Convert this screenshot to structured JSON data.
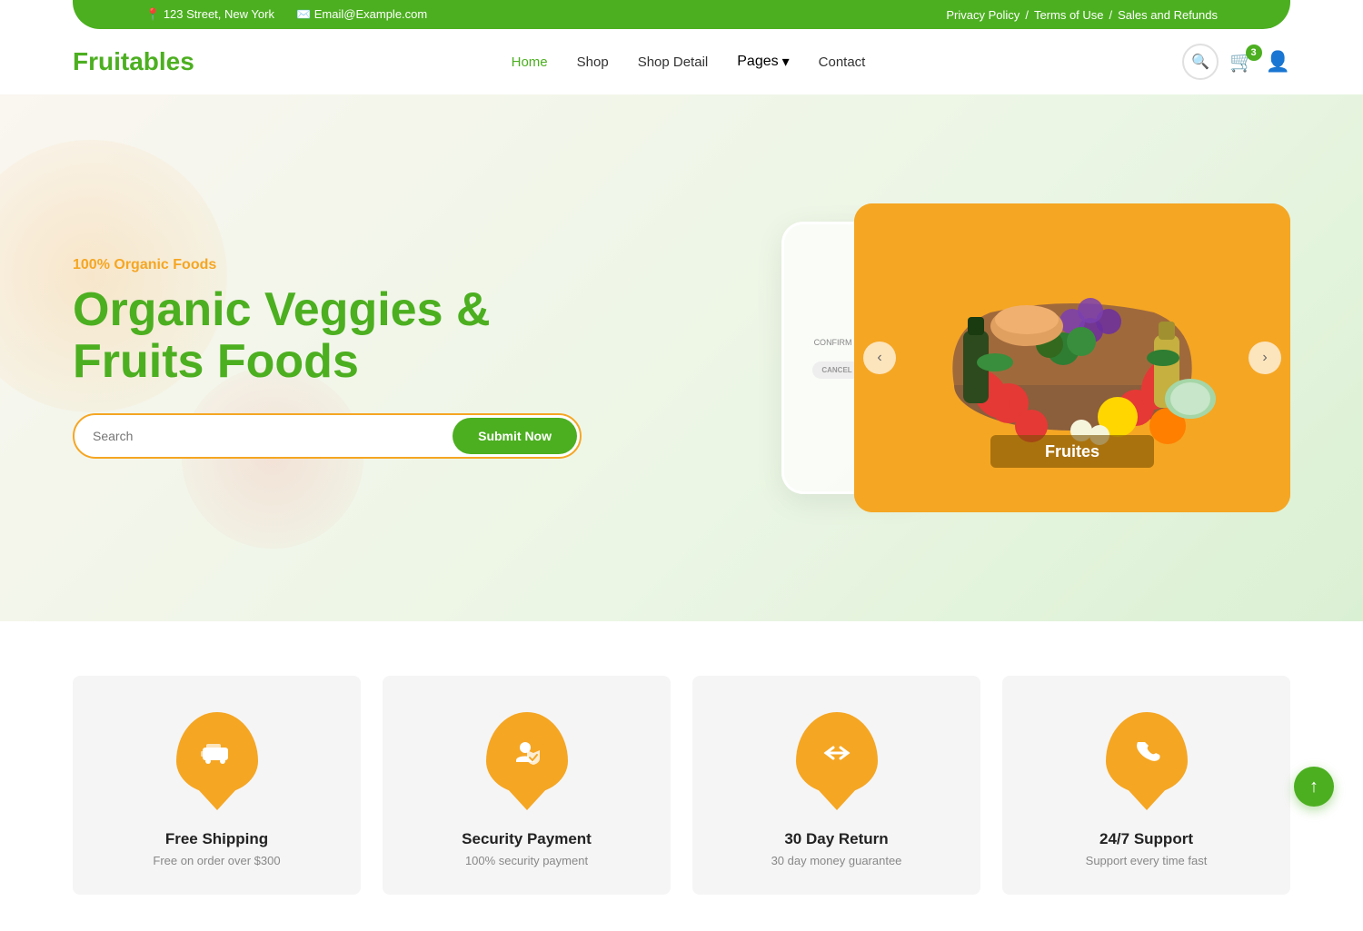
{
  "topbar": {
    "address": "123 Street, New York",
    "email": "Email@Example.com",
    "links": [
      "Privacy Policy",
      "Terms of Use",
      "Sales and Refunds"
    ]
  },
  "header": {
    "logo": "Fruitables",
    "nav": [
      {
        "label": "Home",
        "active": true
      },
      {
        "label": "Shop",
        "active": false
      },
      {
        "label": "Shop Detail",
        "active": false
      },
      {
        "label": "Pages",
        "active": false,
        "hasDropdown": true
      },
      {
        "label": "Contact",
        "active": false
      }
    ],
    "cart_badge": "3",
    "search_icon": "🔍",
    "cart_icon": "🛒",
    "user_icon": "👤"
  },
  "hero": {
    "subtitle": "100% Organic Foods",
    "title": "Organic Veggies & Fruits Foods",
    "search_placeholder": "Search",
    "search_btn": "Submit Now",
    "carousel_label": "Fruites",
    "prev_icon": "‹",
    "next_icon": "›",
    "phone_text": "CONFIRM DELIVERY"
  },
  "features": [
    {
      "icon": "car",
      "title": "Free Shipping",
      "desc": "Free on order over $300"
    },
    {
      "icon": "shield",
      "title": "Security Payment",
      "desc": "100% security payment"
    },
    {
      "icon": "return",
      "title": "30 Day Return",
      "desc": "30 day money guarantee"
    },
    {
      "icon": "phone",
      "title": "24/7 Support",
      "desc": "Support every time fast"
    }
  ],
  "scroll_top_icon": "↑"
}
